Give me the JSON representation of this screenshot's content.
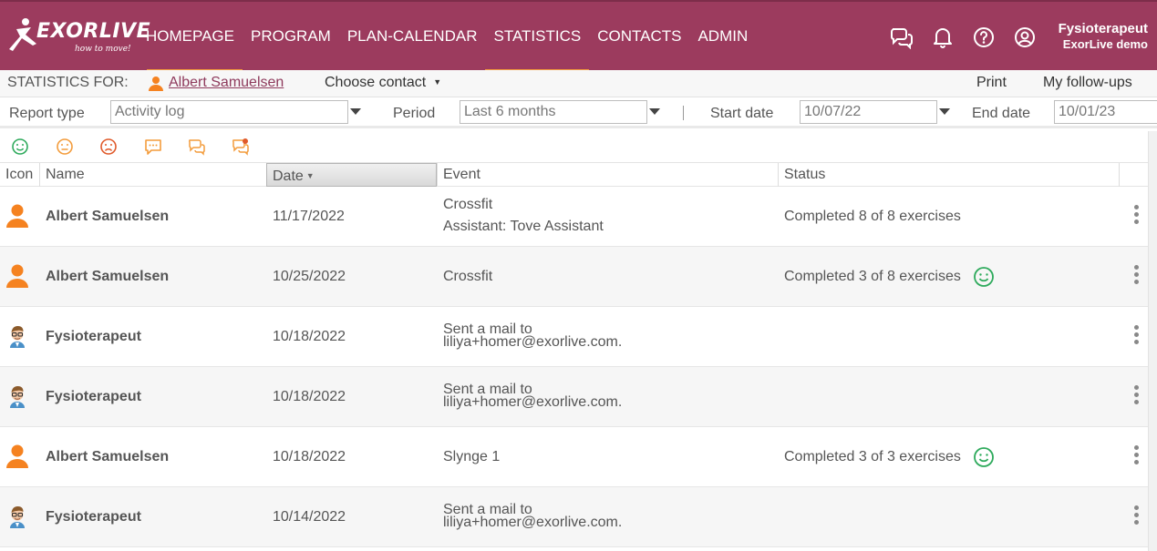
{
  "header": {
    "logo": {
      "wordmark": "EXORLIVE",
      "tagline": "how to move!"
    },
    "nav": [
      {
        "label": "HOMEPAGE"
      },
      {
        "label": "PROGRAM"
      },
      {
        "label": "PLAN-CALENDAR"
      },
      {
        "label": "STATISTICS"
      },
      {
        "label": "CONTACTS"
      },
      {
        "label": "ADMIN"
      }
    ],
    "active_nav": "STATISTICS",
    "icons": [
      "chat-icon",
      "bell-icon",
      "help-icon",
      "account-icon"
    ],
    "user": {
      "name": "Fysioterapeut",
      "org": "ExorLive demo"
    },
    "brand_color": "#9c3b5e",
    "accent_color": "#f39c3c"
  },
  "statsbar": {
    "label": "STATISTICS FOR:",
    "selected_contact": "Albert Samuelsen",
    "choose_contact": "Choose contact",
    "print": "Print",
    "follow_ups": "My follow-ups"
  },
  "filters": {
    "report_type_label": "Report type",
    "report_type_value": "Activity log",
    "period_label": "Period",
    "period_value": "Last 6 months",
    "start_label": "Start date",
    "start_value": "10/07/22",
    "end_label": "End date",
    "end_value": "10/01/23"
  },
  "toolbar": {
    "icons": [
      "happy-face-icon",
      "neutral-face-icon",
      "sad-face-icon",
      "comment-icon",
      "conversation-icon",
      "conversation-alert-icon"
    ],
    "colors": {
      "happy": "#2eaa5c",
      "neutral": "#f39c3c",
      "sad": "#e05a2b",
      "comment": "#f39c3c"
    }
  },
  "table": {
    "columns": {
      "icon": "Icon",
      "name": "Name",
      "date": "Date",
      "event": "Event",
      "status": "Status"
    },
    "sorted_by": "Date",
    "rows": [
      {
        "type": "user",
        "name": "Albert Samuelsen",
        "date": "11/17/2022",
        "event": "Crossfit",
        "event2": "Assistant: Tove Assistant",
        "status": "Completed 8 of 8 exercises",
        "mood": ""
      },
      {
        "type": "user",
        "name": "Albert Samuelsen",
        "date": "10/25/2022",
        "event": "Crossfit",
        "event2": "",
        "status": "Completed 3 of 8 exercises",
        "mood": "happy"
      },
      {
        "type": "therapist",
        "name": "Fysioterapeut",
        "date": "10/18/2022",
        "event": "Sent a mail to",
        "event2": "liliya+homer@exorlive.com.",
        "status": "",
        "mood": ""
      },
      {
        "type": "therapist",
        "name": "Fysioterapeut",
        "date": "10/18/2022",
        "event": "Sent a mail to",
        "event2": "liliya+homer@exorlive.com.",
        "status": "",
        "mood": ""
      },
      {
        "type": "user",
        "name": "Albert Samuelsen",
        "date": "10/18/2022",
        "event": "Slynge 1",
        "event2": "",
        "status": "Completed 3 of 3 exercises",
        "mood": "happy"
      },
      {
        "type": "therapist",
        "name": "Fysioterapeut",
        "date": "10/14/2022",
        "event": "Sent a mail to",
        "event2": "liliya+homer@exorlive.com.",
        "status": "",
        "mood": ""
      }
    ]
  }
}
